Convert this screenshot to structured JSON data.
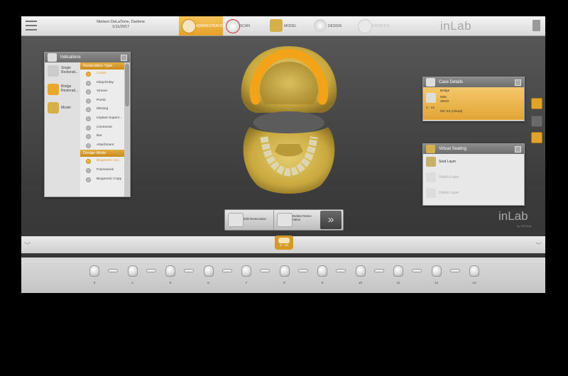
{
  "topbar": {
    "patient_name": "Nielson DeLaTorre, Darlene",
    "patient_date": "1/11/2017",
    "steps": [
      {
        "label": "ADMINISTRATION",
        "state": "active",
        "icon": "clipboard-icon"
      },
      {
        "label": "SCAN",
        "state": "normal",
        "icon": "scan-icon"
      },
      {
        "label": "MODEL",
        "state": "normal",
        "icon": "model-icon"
      },
      {
        "label": "DESIGN",
        "state": "normal",
        "icon": "design-icon"
      },
      {
        "label": "PRODUCE",
        "state": "disabled",
        "icon": "produce-icon"
      }
    ],
    "logo": "inLab"
  },
  "indications": {
    "title": "Indications",
    "types": [
      {
        "label": "Single Restorati...",
        "selected": false
      },
      {
        "label": "Bridge Restorati...",
        "selected": true
      },
      {
        "label": "Model",
        "selected": false
      }
    ],
    "restoration_type_header": "Restoration Type",
    "restoration_types": [
      {
        "label": "Crown",
        "selected": true
      },
      {
        "label": "Inlay/Onlay",
        "selected": false
      },
      {
        "label": "Veneer",
        "selected": false
      },
      {
        "label": "Pontic",
        "selected": false
      },
      {
        "label": "Missing",
        "selected": false
      },
      {
        "label": "Implant Supers...",
        "selected": false
      },
      {
        "label": "Connector",
        "selected": false
      },
      {
        "label": "Bar",
        "selected": false
      },
      {
        "label": "Attachment",
        "selected": false
      }
    ],
    "design_mode_header": "Design Mode",
    "design_modes": [
      {
        "label": "Biogeneric Ind...",
        "selected": true
      },
      {
        "label": "Framework",
        "selected": false
      },
      {
        "label": "Biogeneric Copy",
        "selected": false
      }
    ]
  },
  "case_details": {
    "title": "Case Details",
    "type": "Bridge",
    "material": "Misc",
    "shade": "2M2O",
    "range": "3 - 13",
    "block": "MC XS (virtual)"
  },
  "virtual_seating": {
    "title": "Virtual Seating",
    "items": [
      {
        "label": "Seat Layer",
        "enabled": true
      },
      {
        "label": "Switch Layer",
        "enabled": false
      },
      {
        "label": "Delete Layer",
        "enabled": false
      }
    ]
  },
  "actions": {
    "edit_label": "Edit Restoration",
    "delete_label": "Delete Resto-ration",
    "next_symbol": "»"
  },
  "branding": {
    "logo": "inLab",
    "sub": "by SIRONA"
  },
  "tooth_tab_label": "3 - 13",
  "teeth_numbers": [
    "3",
    "4",
    "5",
    "6",
    "7",
    "8",
    "9",
    "10",
    "11",
    "12",
    "13"
  ],
  "colors": {
    "accent": "#e9a82d",
    "panel_bg": "#e8e8e8",
    "workspace": "#4a4a4a"
  }
}
